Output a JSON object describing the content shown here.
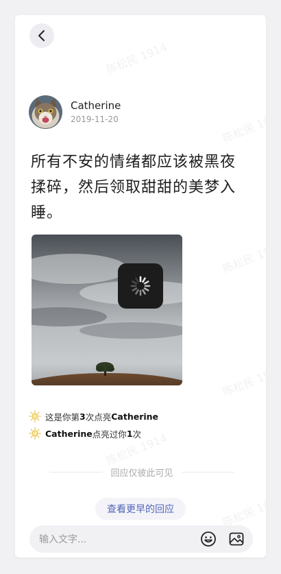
{
  "watermark": "陈松民 1914",
  "header": {
    "back_icon": "chevron-left-icon"
  },
  "post": {
    "author": "Catherine",
    "date": "2019-11-20",
    "text": "所有不安的情绪都应该被黑夜揉碎，然后领取甜甜的美梦入睡。",
    "image_state": "loading"
  },
  "lights": [
    {
      "pre": "这是你第 ",
      "count": "3",
      "mid": " 次点亮 ",
      "name": "Catherine",
      "post": ""
    },
    {
      "pre": "",
      "name": "Catherine",
      "mid": " 点亮过你 ",
      "count": "1",
      "post": " 次"
    }
  ],
  "reply_notice": "回应仅彼此可见",
  "earlier_button": "查看更早的回应",
  "composer": {
    "placeholder": "输入文字...",
    "emoji_icon": "smiley-icon",
    "image_icon": "image-icon"
  },
  "colors": {
    "accent": "#5566b8",
    "sun": "#e8c24a"
  }
}
